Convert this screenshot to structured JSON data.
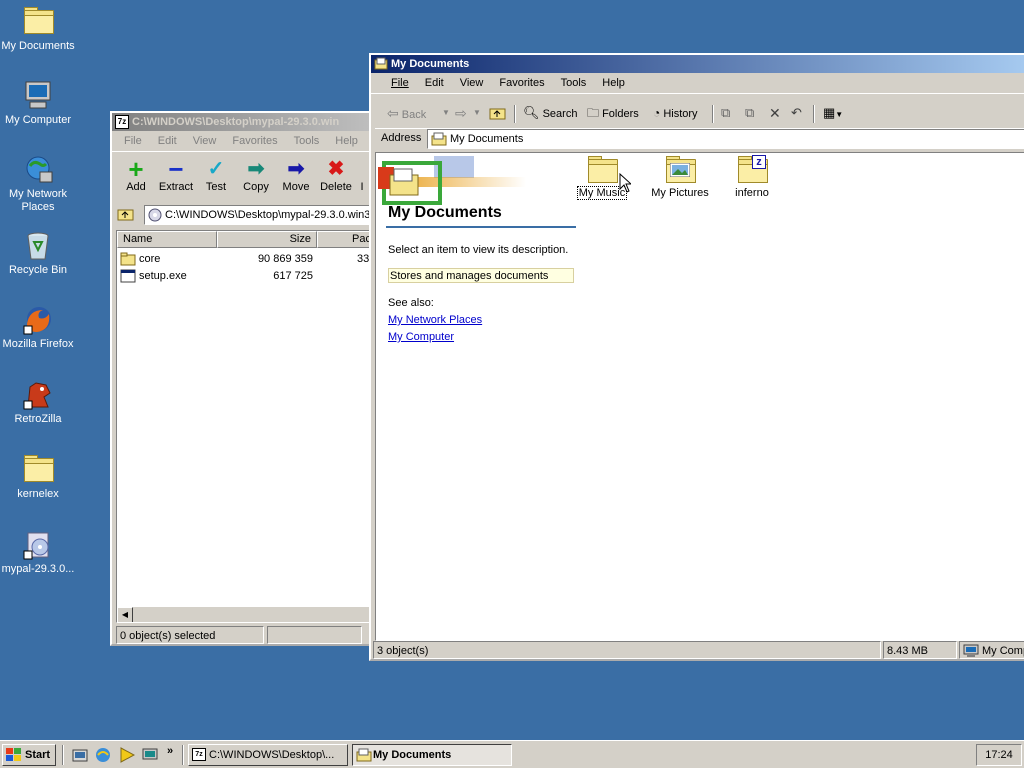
{
  "desktop": {
    "icons": [
      {
        "label": "My Documents",
        "icon": "my-documents-icon"
      },
      {
        "label": "My Computer",
        "icon": "my-computer-icon"
      },
      {
        "label_line1": "My Network",
        "label_line2": "Places",
        "icon": "network-places-icon"
      },
      {
        "label": "Recycle Bin",
        "icon": "recycle-bin-icon"
      },
      {
        "label": "Mozilla Firefox",
        "icon": "firefox-icon"
      },
      {
        "label": "RetroZilla",
        "icon": "retrozilla-icon"
      },
      {
        "label": "kernelex",
        "icon": "folder-icon"
      },
      {
        "label": "mypal-29.3.0...",
        "icon": "installer-icon"
      }
    ]
  },
  "zip_window": {
    "title": "C:\\WINDOWS\\Desktop\\mypal-29.3.0.win",
    "menu": [
      "File",
      "Edit",
      "View",
      "Favorites",
      "Tools",
      "Help"
    ],
    "toolbar": [
      {
        "label": "Add",
        "icon": "add-icon"
      },
      {
        "label": "Extract",
        "icon": "extract-icon"
      },
      {
        "label": "Test",
        "icon": "test-icon"
      },
      {
        "label": "Copy",
        "icon": "copy-icon"
      },
      {
        "label": "Move",
        "icon": "move-icon"
      },
      {
        "label": "Delete",
        "icon": "delete-icon"
      },
      {
        "label": "I",
        "icon": "info-icon"
      }
    ],
    "path": "C:\\WINDOWS\\Desktop\\mypal-29.3.0.win3",
    "columns": [
      "Name",
      "Size",
      "Pac"
    ],
    "rows": [
      {
        "name": "core",
        "size": "90 869 359",
        "packed": "33",
        "icon": "folder-icon"
      },
      {
        "name": "setup.exe",
        "size": "617 725",
        "packed": "",
        "icon": "exe-icon"
      }
    ],
    "status": "0 object(s) selected"
  },
  "explorer": {
    "title": "My Documents",
    "menu": [
      "File",
      "Edit",
      "View",
      "Favorites",
      "Tools",
      "Help"
    ],
    "toolbar": {
      "back": "Back",
      "search": "Search",
      "folders": "Folders",
      "history": "History"
    },
    "address_label": "Address",
    "address_value": "My Documents",
    "panel": {
      "heading": "My Documents",
      "prompt": "Select an item to view its description.",
      "description": "Stores and manages documents",
      "see_also": "See also:",
      "links": [
        "My Network Places",
        "My Computer"
      ]
    },
    "items": [
      {
        "label": "My Music",
        "icon": "folder-icon"
      },
      {
        "label": "My Pictures",
        "icon": "pictures-folder-icon"
      },
      {
        "label": "inferno",
        "icon": "zip-folder-icon"
      }
    ],
    "status": {
      "count": "3 object(s)",
      "size": "8.43 MB",
      "zone": "My Comp"
    }
  },
  "taskbar": {
    "start": "Start",
    "tasks": [
      {
        "label": "C:\\WINDOWS\\Desktop\\...",
        "active": false
      },
      {
        "label": "My Documents",
        "active": true
      }
    ],
    "chevron": "»",
    "clock": "17:24"
  }
}
